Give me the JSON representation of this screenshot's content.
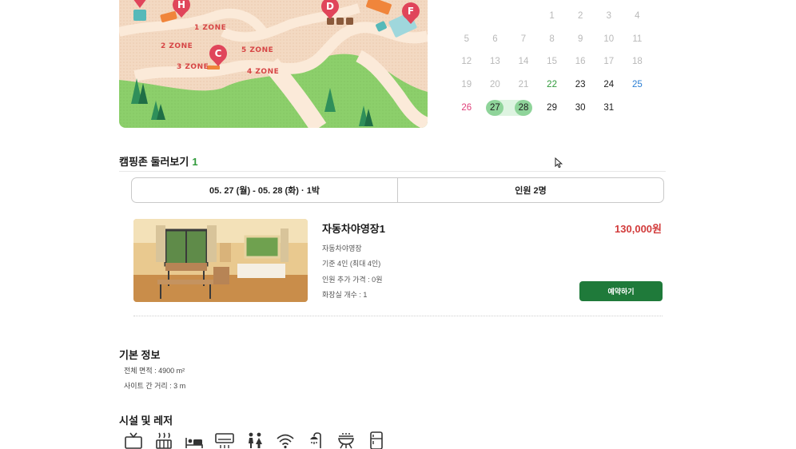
{
  "map": {
    "pins": [
      {
        "letter": "",
        "color": "#e0455a"
      },
      {
        "letter": "H",
        "color": "#e0455a"
      },
      {
        "letter": "D",
        "color": "#e0455a"
      },
      {
        "letter": "F",
        "color": "#e0455a"
      },
      {
        "letter": "C",
        "color": "#e0455a"
      }
    ],
    "zones": [
      "1 ZONE",
      "2 ZONE",
      "3 ZONE",
      "4 ZONE",
      "5 ZONE"
    ]
  },
  "calendar": {
    "weeks": [
      [
        "",
        "",
        "",
        "1",
        "2",
        "3",
        "4"
      ],
      [
        "5",
        "6",
        "7",
        "8",
        "9",
        "10",
        "11"
      ],
      [
        "12",
        "13",
        "14",
        "15",
        "16",
        "17",
        "18"
      ],
      [
        "19",
        "20",
        "21",
        "22",
        "23",
        "24",
        "25"
      ],
      [
        "26",
        "27",
        "28",
        "29",
        "30",
        "31",
        ""
      ]
    ],
    "today": "22",
    "selected": [
      "27",
      "28"
    ],
    "available_from": 22,
    "colors": {
      "today": "#2f9a3a",
      "saturday": "#2b7fd4",
      "sunday": "#e0407a",
      "selected": "#8fd49a"
    }
  },
  "zones_section": {
    "title": "캠핑존 둘러보기",
    "count": "1"
  },
  "filter": {
    "dates": "05. 27 (월) - 05. 28 (화) · 1박",
    "guests": "인원 2명"
  },
  "site": {
    "name": "자동차야영장1",
    "price": "130,000원",
    "type": "자동차야영장",
    "capacity": "기준 4인 (최대 4인)",
    "extra_fee": "인원 추가 가격 : 0원",
    "restrooms": "화장실 개수 : 1",
    "reserve_label": "예약하기",
    "colors": {
      "price": "#d23b3b",
      "button": "#1f7a3a"
    }
  },
  "basic_info": {
    "title": "기본 정보",
    "area": "전체 면적 : 4900 m²",
    "site_distance": "사이트 간 거리 : 3 m"
  },
  "facilities": {
    "title": "시설 및 레저",
    "icons": [
      "tv-icon",
      "heater-icon",
      "bed-icon",
      "air-conditioner-icon",
      "restroom-icon",
      "wifi-icon",
      "shower-icon",
      "barbecue-grill-icon",
      "refrigerator-icon"
    ]
  }
}
